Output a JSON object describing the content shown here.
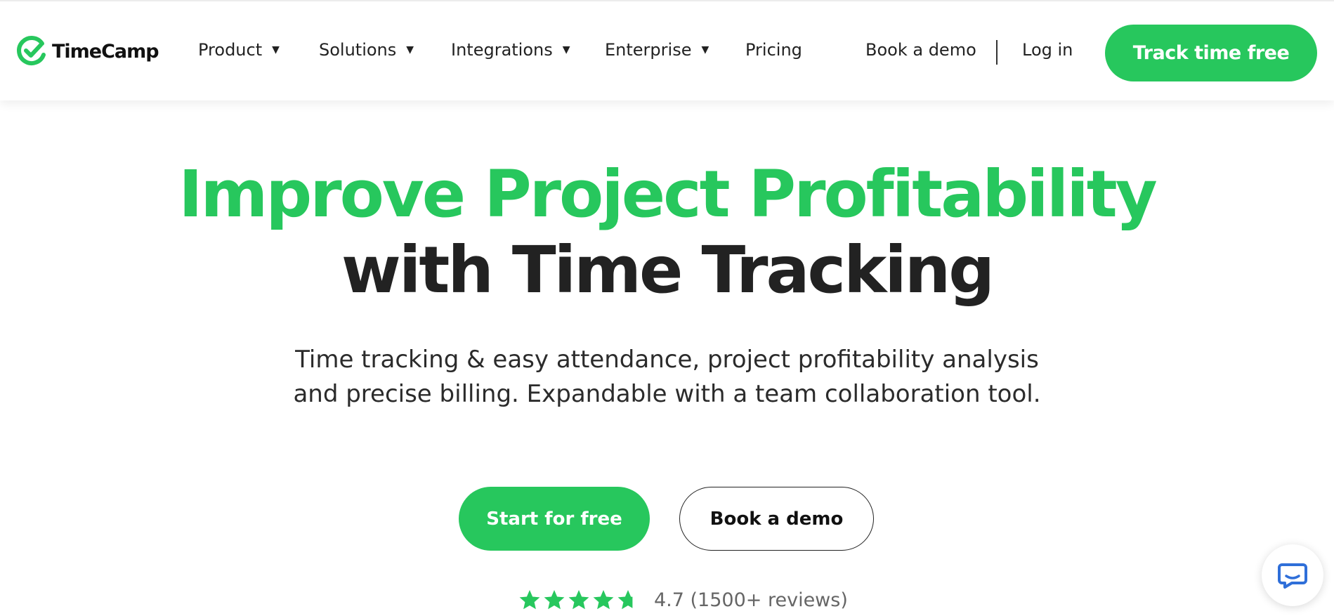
{
  "brand": {
    "name": "TimeCamp",
    "accent_color": "#27c75d",
    "logo_icon": "checkmark-circle-icon"
  },
  "nav": {
    "items": [
      {
        "label": "Product",
        "has_dropdown": true
      },
      {
        "label": "Solutions",
        "has_dropdown": true
      },
      {
        "label": "Integrations",
        "has_dropdown": true
      },
      {
        "label": "Enterprise",
        "has_dropdown": true
      },
      {
        "label": "Pricing",
        "has_dropdown": false
      }
    ],
    "caret": "▼",
    "book_demo": "Book a demo",
    "login": "Log in",
    "cta": "Track time free"
  },
  "hero": {
    "title_line1": "Improve Project Profitability",
    "title_line2": "with Time Tracking",
    "subtitle_line1": "Time tracking & easy attendance, project profitability analysis",
    "subtitle_line2": "and precise billing. Expandable with a team collaboration tool.",
    "primary_button": "Start for free",
    "secondary_button": "Book a demo",
    "rating_value": 4.7,
    "rating_text": "4.7 (1500+ reviews)"
  },
  "chat": {
    "icon": "chat-bubble-icon",
    "color": "#2f6fd9"
  }
}
